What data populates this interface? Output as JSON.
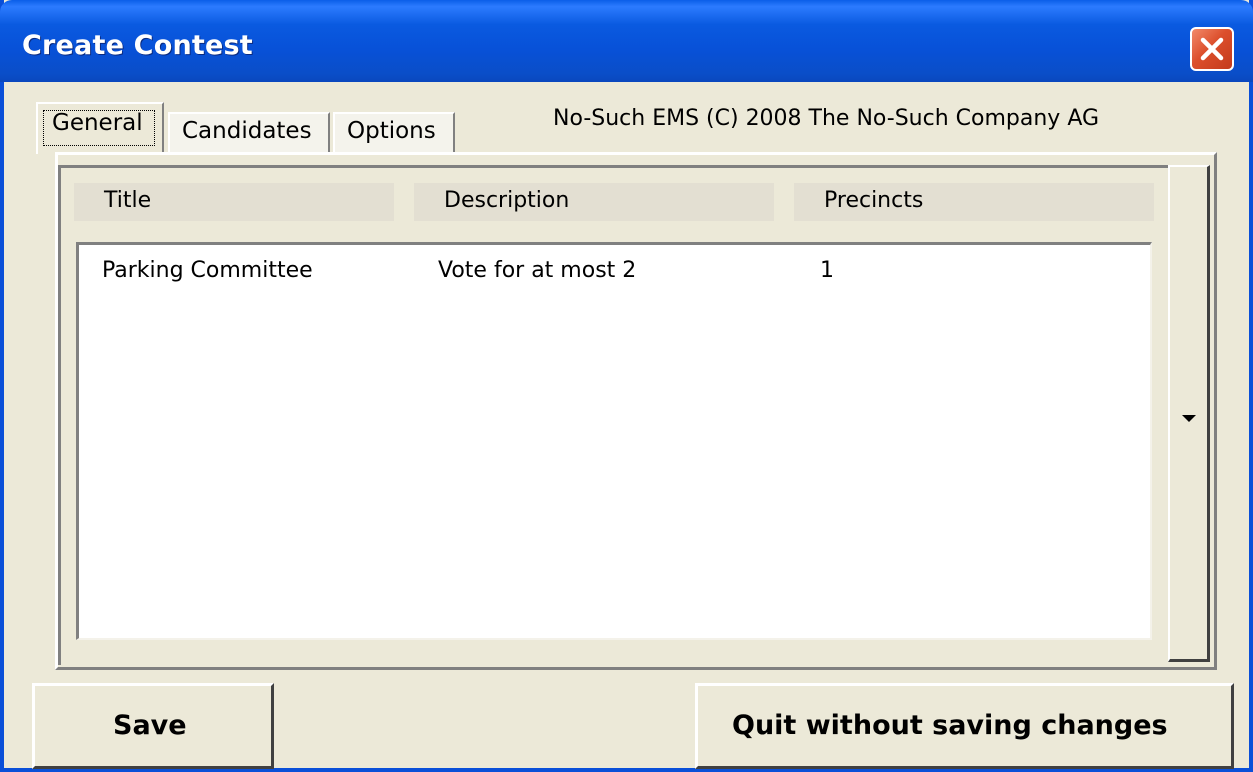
{
  "window": {
    "title": "Create Contest"
  },
  "tabs": [
    {
      "label": "General",
      "selected": true
    },
    {
      "label": "Candidates",
      "selected": false
    },
    {
      "label": "Options",
      "selected": false
    }
  ],
  "copyright": "No-Such EMS (C) 2008 The No-Such Company AG",
  "table": {
    "headers": [
      "Title",
      "Description",
      "Precincts"
    ],
    "rows": [
      {
        "title": "Parking Committee",
        "description": "Vote for at most 2",
        "precincts": "1"
      }
    ]
  },
  "buttons": {
    "save": "Save",
    "quit": "Quit without saving changes"
  },
  "icons": {
    "close": "close-icon",
    "scroll_down": "chevron-down-icon"
  },
  "colors": {
    "titlebar": "#0a5ae0",
    "window_bg": "#ece9d8",
    "close": "#dc4f2c"
  }
}
